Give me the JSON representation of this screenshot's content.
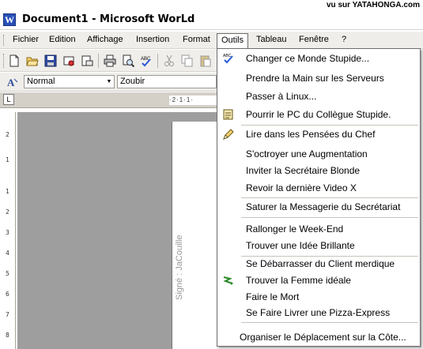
{
  "watermark": "vu sur YATAHONGA.com",
  "window": {
    "title": "Document1 - Microsoft WorLd",
    "app_icon_letter": "W"
  },
  "menubar": {
    "items": [
      "Fichier",
      "Edition",
      "Affichage",
      "Insertion",
      "Format",
      "Outils",
      "Tableau",
      "Fenêtre",
      "?"
    ],
    "active": "Outils"
  },
  "toolbar_standard": {
    "icons": [
      "new-document-icon",
      "open-folder-icon",
      "save-icon",
      "permissions-icon",
      "email-icon",
      "print-icon",
      "print-preview-icon",
      "spelling-icon",
      "cut-icon",
      "copy-icon"
    ]
  },
  "toolbar_formatting": {
    "style_value": "Normal",
    "font_value": "Zoubir"
  },
  "ruler": {
    "corner_glyph": "L",
    "horizontal_marks": "·2·1·1·",
    "vertical_marks": [
      "2",
      "1",
      "1",
      "2",
      "3",
      "4",
      "5",
      "6",
      "7",
      "8"
    ]
  },
  "document": {
    "signature": "Signé : JaCouille"
  },
  "outils_menu": {
    "groups": [
      {
        "items": [
          {
            "label": "Changer ce Monde Stupide...",
            "icon": "spelling-check-icon"
          },
          {
            "label": "Prendre la Main sur les Serveurs",
            "icon": ""
          },
          {
            "label": "Passer à Linux...",
            "icon": ""
          },
          {
            "label": "Pourrir le PC du Collègue Stupide.",
            "icon": "track-changes-icon"
          }
        ]
      },
      {
        "items": [
          {
            "label": "Lire dans les Pensées du Chef",
            "icon": "pencil-icon"
          },
          {
            "label": "S'octroyer une Augmentation",
            "icon": ""
          },
          {
            "label": "Inviter la Secrétaire Blonde",
            "icon": ""
          },
          {
            "label": "Revoir la dernière Video X",
            "icon": ""
          }
        ]
      },
      {
        "items": [
          {
            "label": "Saturer la Messagerie du Secrétariat",
            "icon": ""
          }
        ]
      },
      {
        "items": [
          {
            "label": "Rallonger le Week-End",
            "icon": ""
          },
          {
            "label": "Trouver une Idée Brillante",
            "icon": ""
          }
        ]
      },
      {
        "items": [
          {
            "label": "Se Débarrasser du Client merdique",
            "icon": ""
          },
          {
            "label": "Trouver la Femme idéale",
            "icon": "macro-icon"
          },
          {
            "label": "Faire le Mort",
            "icon": ""
          },
          {
            "label": "Se Faire Livrer une Pizza-Express",
            "icon": ""
          }
        ]
      },
      {
        "items": [
          {
            "label": "Organiser le Déplacement sur la Côte...",
            "icon": ""
          }
        ]
      }
    ]
  }
}
